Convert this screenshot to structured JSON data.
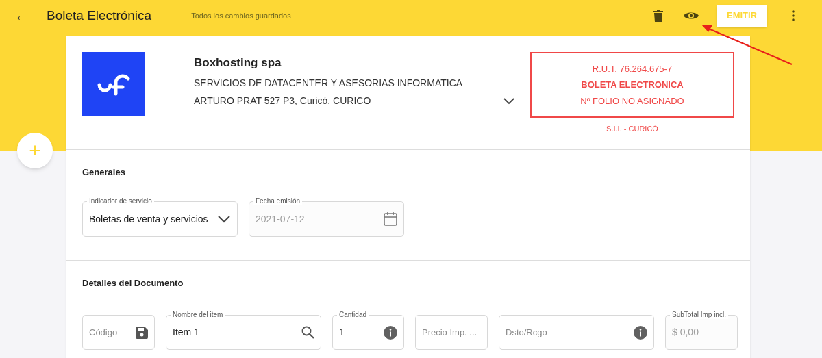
{
  "toolbar": {
    "back": "←",
    "title": "Boleta Electrónica",
    "save_status": "Todos los cambios guardados",
    "emit_button": "EMITIR"
  },
  "company": {
    "name": "Boxhosting spa",
    "activity": "SERVICIOS DE DATACENTER Y ASESORIAS INFORMATICA",
    "address": "ARTURO PRAT 527 P3, Curicó, CURICO",
    "expanded": false
  },
  "tax_box": {
    "rut": "R.U.T. 76.264.675-7",
    "doc_type": "BOLETA ELECTRONICA",
    "folio": "Nº FOLIO NO ASIGNADO",
    "office": "S.I.I. - CURICÓ"
  },
  "add_button": "+",
  "sections": [
    {
      "title": "Generales",
      "fields": [
        {
          "kind": "dropdown",
          "label": "Indicador de servicio",
          "value": "Boletas de venta y servicios",
          "disabled": false
        },
        {
          "kind": "date",
          "label": "Fecha emisión",
          "value": "2021-07-12",
          "disabled": true
        }
      ]
    },
    {
      "title": "Detalles del Documento",
      "fields": [
        {
          "kind": "code",
          "placeholder": "Código",
          "disabled": false
        },
        {
          "kind": "search",
          "label": "Nombre del item",
          "value": "Item 1",
          "disabled": false
        },
        {
          "kind": "info",
          "label": "Cantidad",
          "value": "1",
          "disabled": false
        },
        {
          "kind": "plain",
          "placeholder": "Precio Imp. ...",
          "disabled": false
        },
        {
          "kind": "info",
          "placeholder": "Dsto/Rcgo",
          "disabled": false
        },
        {
          "kind": "plain",
          "label": "SubTotal Imp incl.",
          "value": "$ 0,00",
          "disabled": true
        }
      ]
    }
  ]
}
